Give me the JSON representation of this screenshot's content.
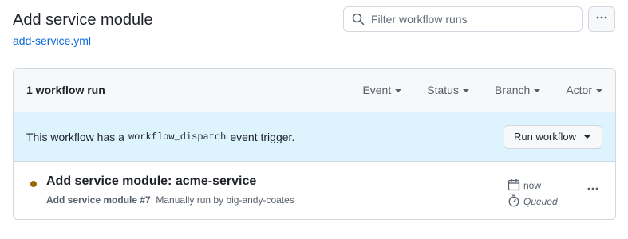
{
  "header": {
    "title": "Add service module",
    "workflow_file": "add-service.yml",
    "search_placeholder": "Filter workflow runs"
  },
  "runs_box": {
    "count_label": "1 workflow run",
    "filters": [
      {
        "label": "Event"
      },
      {
        "label": "Status"
      },
      {
        "label": "Branch"
      },
      {
        "label": "Actor"
      }
    ],
    "banner": {
      "text_before": "This workflow has a",
      "code": "workflow_dispatch",
      "text_after": "event trigger.",
      "button_label": "Run workflow"
    },
    "runs": [
      {
        "title": "Add service module: acme-service",
        "workflow_name": "Add service module #7",
        "description": ": Manually run by big-andy-coates",
        "time": "now",
        "status": "Queued",
        "status_color": "#9a6700"
      }
    ]
  },
  "icons": {
    "search": "search-icon",
    "more": "kebab-horizontal-icon",
    "calendar": "calendar-icon",
    "stopwatch": "stopwatch-icon"
  }
}
